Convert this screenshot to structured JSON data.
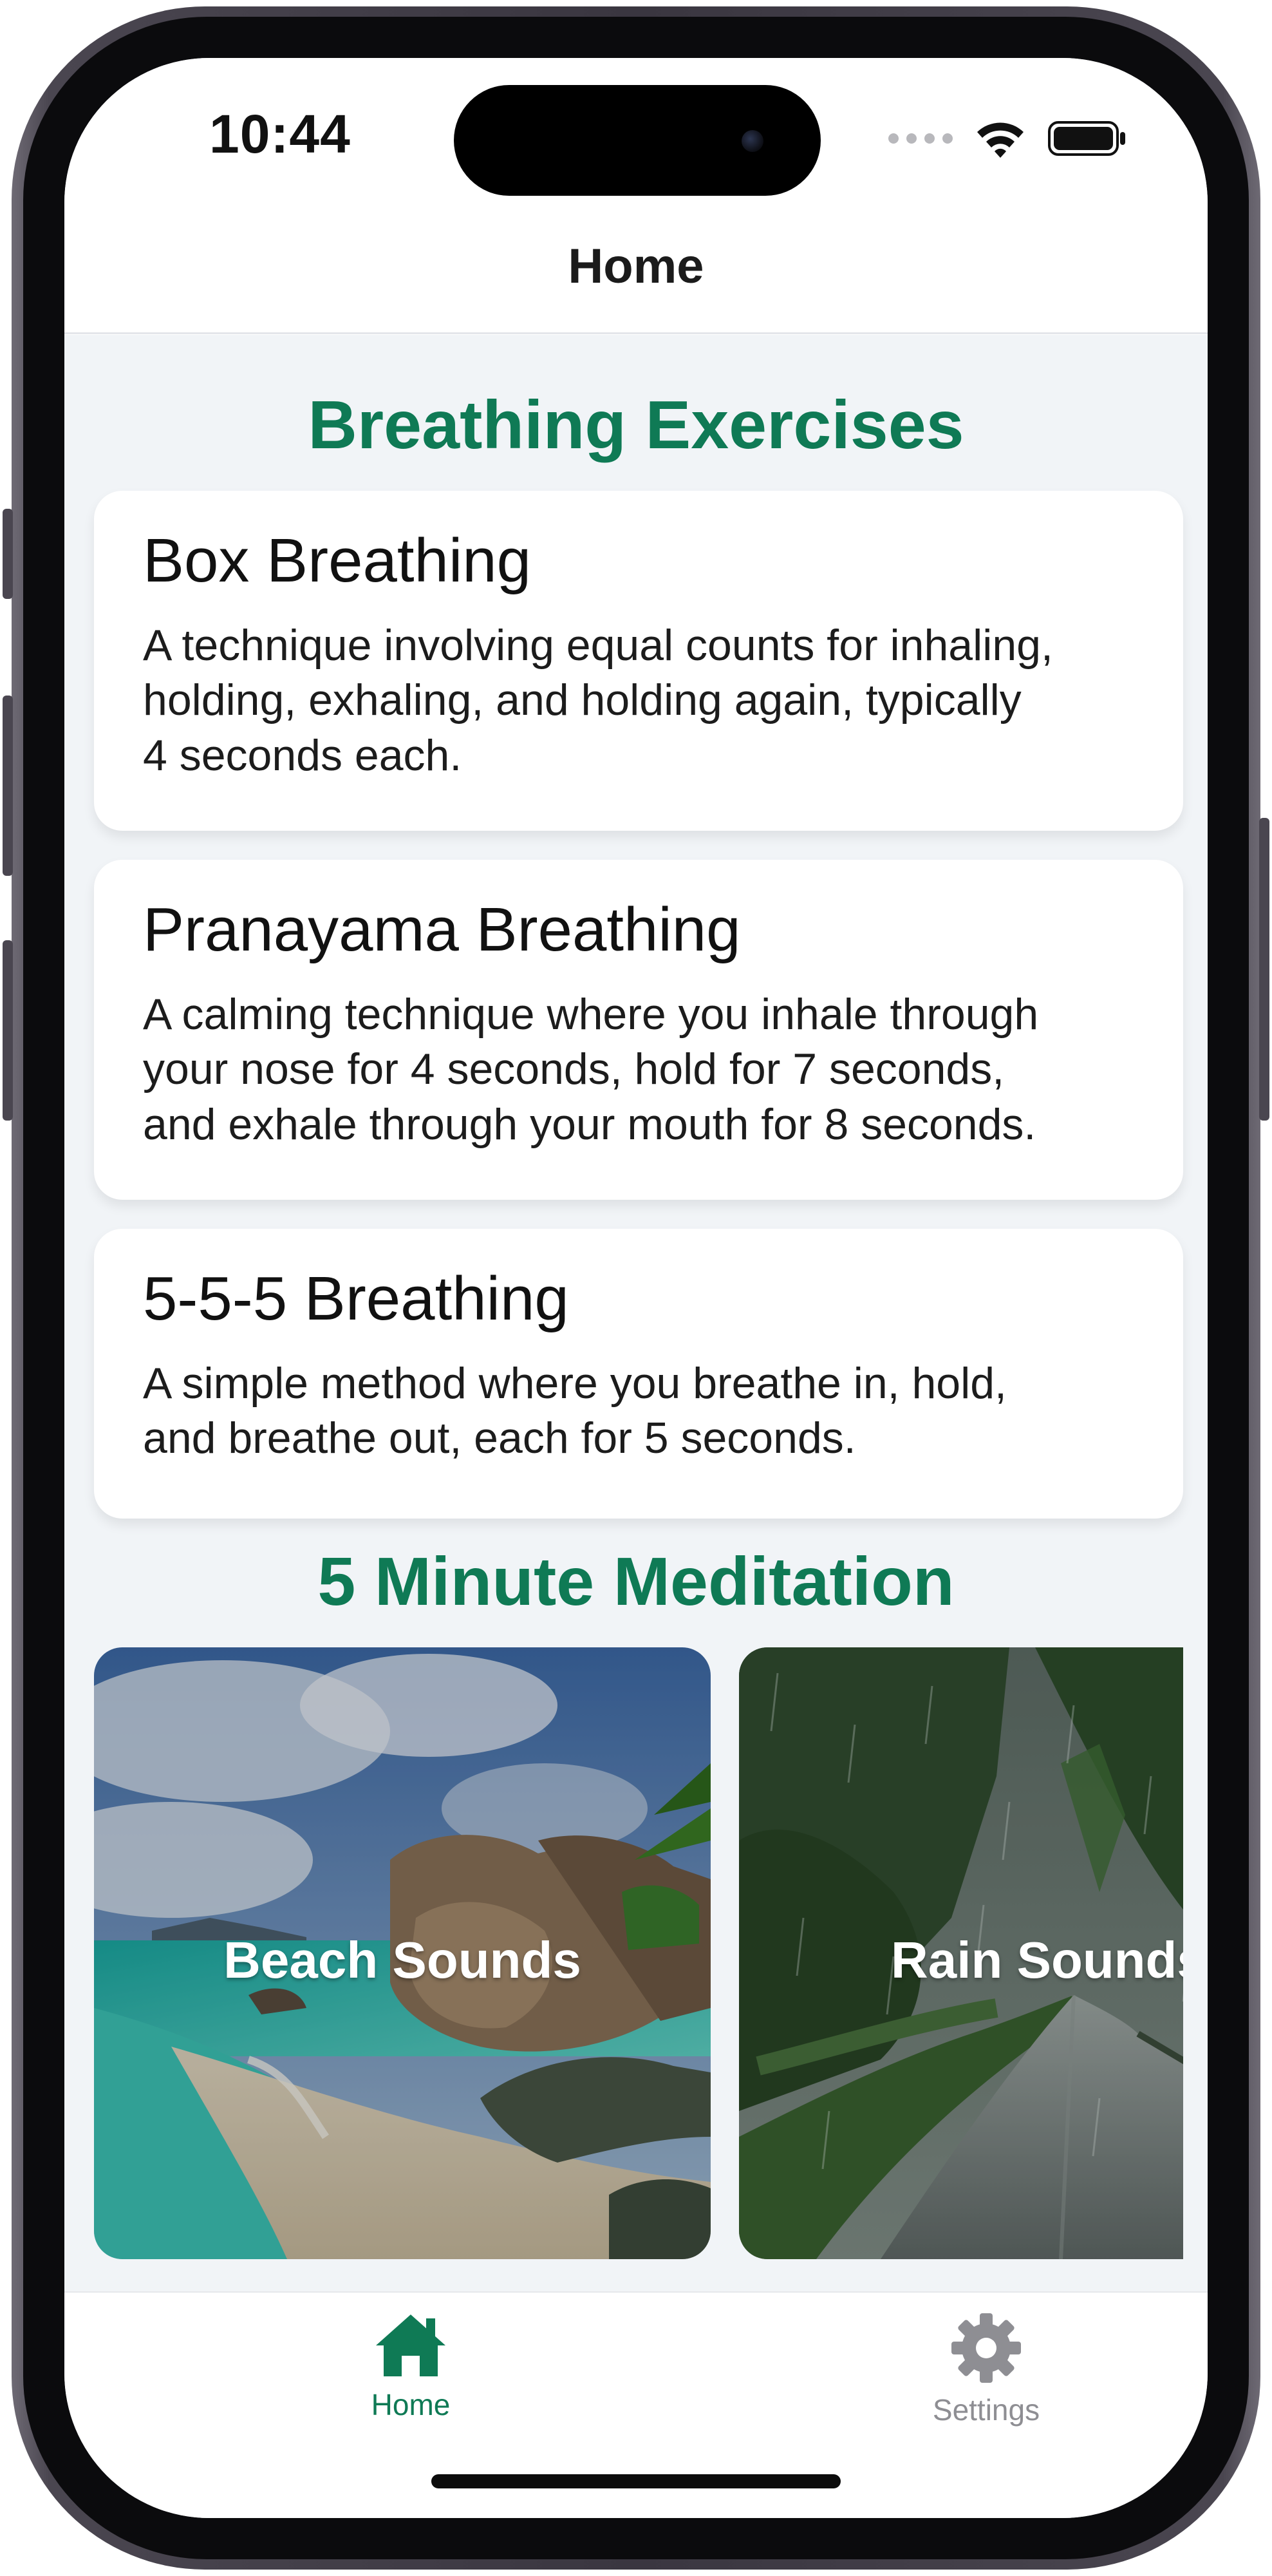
{
  "status_bar": {
    "time": "10:44",
    "icons": [
      "signal-dots-icon",
      "wifi-icon",
      "battery-icon"
    ]
  },
  "nav": {
    "title": "Home"
  },
  "breathing": {
    "section_title": "Breathing Exercises",
    "items": [
      {
        "title": "Box Breathing",
        "desc_lines": [
          "A technique involving equal counts for inhaling,",
          "holding, exhaling, and holding again, typically",
          "4 seconds each."
        ]
      },
      {
        "title": "Pranayama Breathing",
        "desc_lines": [
          "A calming technique where you inhale through",
          "your nose for 4 seconds, hold for 7 seconds,",
          "and exhale through your mouth for 8 seconds."
        ]
      },
      {
        "title": "5-5-5 Breathing",
        "desc_lines": [
          "A simple method where you breathe in, hold,",
          "and breathe out, each for 5 seconds."
        ]
      }
    ]
  },
  "meditation": {
    "section_title": "5 Minute Meditation",
    "tiles": [
      {
        "label": "Beach Sounds",
        "image": "beach-scene"
      },
      {
        "label": "Rain Sounds",
        "image": "rain-forest-road-scene"
      }
    ]
  },
  "tab_bar": {
    "tabs": [
      {
        "label": "Home",
        "icon": "house-icon",
        "active": true
      },
      {
        "label": "Settings",
        "icon": "gear-icon",
        "active": false
      }
    ]
  },
  "colors": {
    "accent": "#0f7a55",
    "background": "#f1f4f7",
    "inactive_tab": "#8e8e93"
  }
}
